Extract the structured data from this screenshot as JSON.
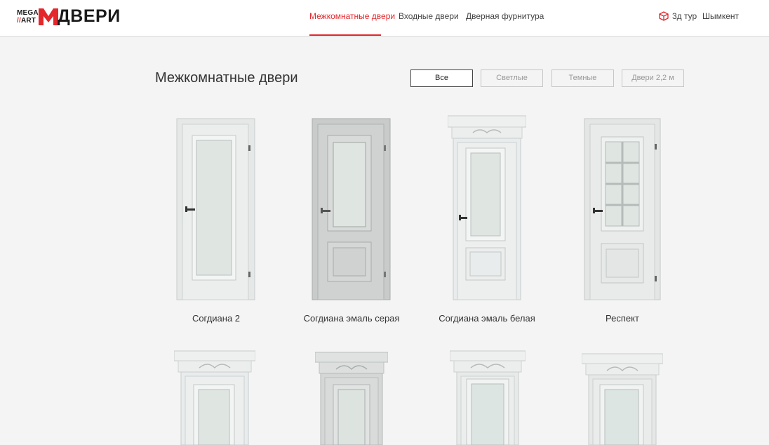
{
  "brand": {
    "line1": "MEGA",
    "line2": "ART",
    "word": "ДВЕРИ",
    "accent": "#e3272c"
  },
  "nav": {
    "items": [
      {
        "label": "Межкомнатные двери",
        "active": true
      },
      {
        "label": "Входные двери",
        "active": false
      },
      {
        "label": "Дверная фурнитура",
        "active": false
      }
    ],
    "tour_label": "3д тур",
    "tour_icon": "cube-icon",
    "city": "Шымкент"
  },
  "page": {
    "title": "Межкомнатные двери"
  },
  "filters": [
    {
      "label": "Все",
      "active": true
    },
    {
      "label": "Светлые",
      "active": false
    },
    {
      "label": "Темные",
      "active": false
    },
    {
      "label": "Двери 2,2 м",
      "active": false
    }
  ],
  "products": [
    {
      "name": "Согдиана 2",
      "color": "#e7e9e8"
    },
    {
      "name": "Согдиана эмаль серая",
      "color": "#c9ccca"
    },
    {
      "name": "Согдиана эмаль белая",
      "color": "#e9ecec"
    },
    {
      "name": "Респект",
      "color": "#e4e7e6"
    },
    {
      "name": "",
      "color": "#eceeee"
    },
    {
      "name": "",
      "color": "#d5d7d6"
    },
    {
      "name": "",
      "color": "#e8eae9"
    },
    {
      "name": "",
      "color": "#e6e8e7"
    }
  ]
}
